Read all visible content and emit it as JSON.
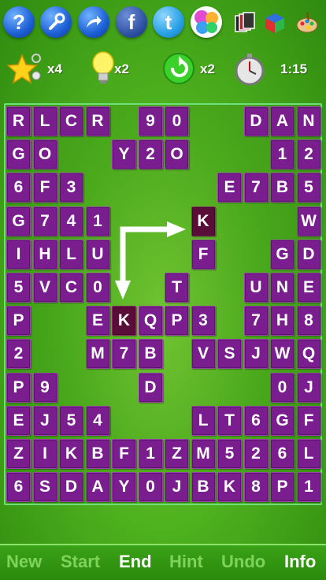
{
  "top_icons": [
    {
      "name": "help-icon",
      "glyph": "?"
    },
    {
      "name": "settings-wrench-icon",
      "glyph": ""
    },
    {
      "name": "share-icon",
      "glyph": ""
    },
    {
      "name": "facebook-icon",
      "glyph": "f"
    },
    {
      "name": "twitter-icon",
      "glyph": "t"
    },
    {
      "name": "game-center-icon",
      "glyph": ""
    },
    {
      "name": "cards-icon",
      "glyph": ""
    },
    {
      "name": "cube-icon",
      "glyph": ""
    },
    {
      "name": "palette-icon",
      "glyph": ""
    }
  ],
  "status": {
    "stars_count": "x4",
    "hints_count": "x2",
    "undo_count": "x2",
    "timer": "1:15"
  },
  "colors": {
    "tile": "#7a1d8e",
    "tile_selected": "#5a0d38",
    "arrow": "#ffffff",
    "board_border": "#6ee07a"
  },
  "board": {
    "rows": [
      [
        "R",
        "L",
        "C",
        "R",
        "",
        "9",
        "0",
        "",
        "",
        "D",
        "A",
        "N"
      ],
      [
        "G",
        "O",
        "",
        "",
        "Y",
        "2",
        "O",
        "",
        "",
        "",
        "1",
        "2"
      ],
      [
        "6",
        "F",
        "3",
        "",
        "",
        "",
        "",
        "",
        "E",
        "7",
        "B",
        "5"
      ],
      [
        "G",
        "7",
        "4",
        "1",
        "",
        "",
        "",
        "K",
        "",
        "",
        "",
        "W"
      ],
      [
        "I",
        "H",
        "L",
        "U",
        "",
        "",
        "",
        "F",
        "",
        "",
        "G",
        "D"
      ],
      [
        "5",
        "V",
        "C",
        "0",
        "",
        "",
        "T",
        "",
        "",
        "U",
        "N",
        "E"
      ],
      [
        "P",
        "",
        "",
        "E",
        "K",
        "Q",
        "P",
        "3",
        "",
        "7",
        "H",
        "8"
      ],
      [
        "2",
        "",
        "",
        "M",
        "7",
        "B",
        "",
        "V",
        "S",
        "J",
        "W",
        "Q"
      ],
      [
        "P",
        "9",
        "",
        "",
        "",
        "D",
        "",
        "",
        "",
        "",
        "0",
        "J"
      ],
      [
        "E",
        "J",
        "5",
        "4",
        "",
        "",
        "",
        "L",
        "T",
        "6",
        "G",
        "F"
      ],
      [
        "Z",
        "I",
        "K",
        "B",
        "F",
        "1",
        "Z",
        "M",
        "5",
        "2",
        "6",
        "L"
      ],
      [
        "6",
        "S",
        "D",
        "A",
        "Y",
        "0",
        "J",
        "B",
        "K",
        "8",
        "P",
        "1"
      ]
    ],
    "selected": [
      [
        3,
        7
      ],
      [
        6,
        4
      ]
    ]
  },
  "bottom_buttons": [
    {
      "label": "New",
      "active": false
    },
    {
      "label": "Start",
      "active": false
    },
    {
      "label": "End",
      "active": true
    },
    {
      "label": "Hint",
      "active": false
    },
    {
      "label": "Undo",
      "active": false
    },
    {
      "label": "Info",
      "active": true
    }
  ]
}
